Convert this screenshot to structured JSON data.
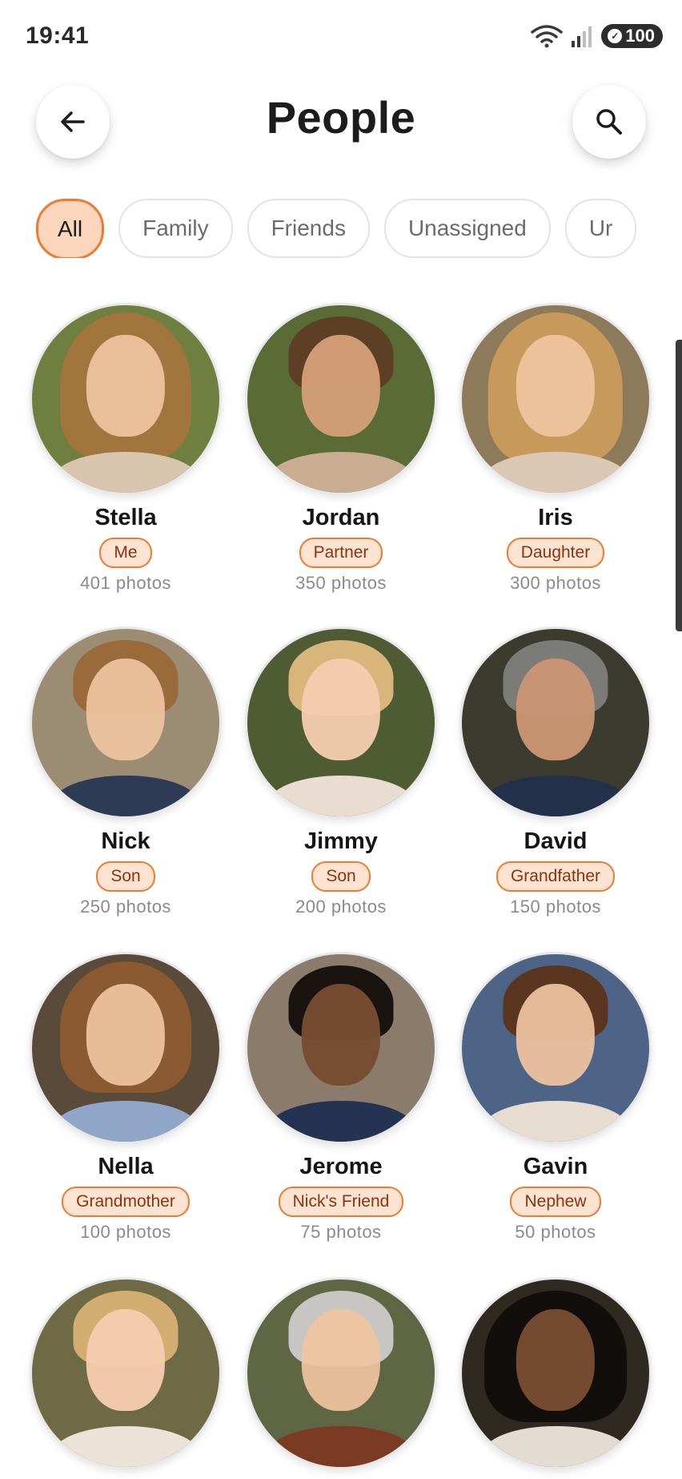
{
  "status_bar": {
    "time": "19:41",
    "battery": "100"
  },
  "header": {
    "title": "People"
  },
  "filters": [
    {
      "label": "All",
      "active": true
    },
    {
      "label": "Family",
      "active": false
    },
    {
      "label": "Friends",
      "active": false
    },
    {
      "label": "Unassigned",
      "active": false
    },
    {
      "label": "Ur",
      "active": false
    }
  ],
  "people": [
    {
      "name": "Stella",
      "relation": "Me",
      "photos": "401 photos"
    },
    {
      "name": "Jordan",
      "relation": "Partner",
      "photos": "350 photos"
    },
    {
      "name": "Iris",
      "relation": "Daughter",
      "photos": "300 photos"
    },
    {
      "name": "Nick",
      "relation": "Son",
      "photos": "250 photos"
    },
    {
      "name": "Jimmy",
      "relation": "Son",
      "photos": "200 photos"
    },
    {
      "name": "David",
      "relation": "Grandfather",
      "photos": "150 photos"
    },
    {
      "name": "Nella",
      "relation": "Grandmother",
      "photos": "100 photos"
    },
    {
      "name": "Jerome",
      "relation": "Nick's Friend",
      "photos": "75 photos"
    },
    {
      "name": "Gavin",
      "relation": "Nephew",
      "photos": "50 photos"
    }
  ],
  "colors": {
    "accent": "#f07a2e",
    "accent_soft": "#fbd6bd",
    "badge_bg": "#fde3d1",
    "badge_text": "#8a3410"
  }
}
